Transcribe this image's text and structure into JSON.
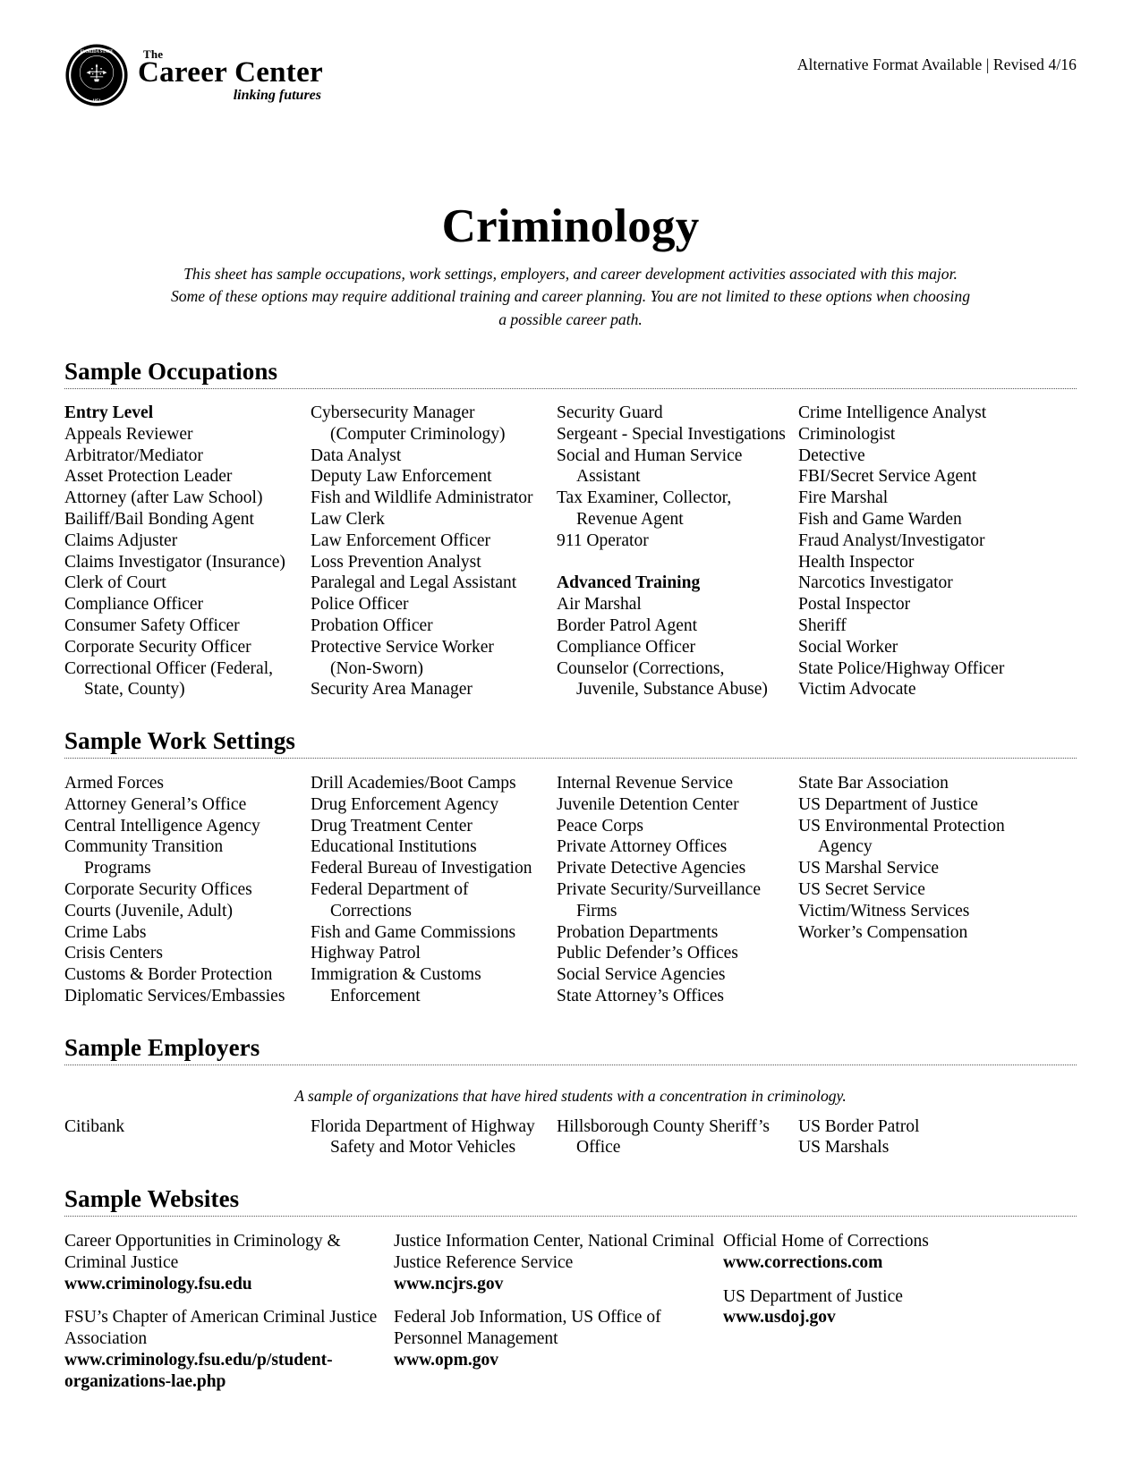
{
  "header": {
    "revised_note": "Alternative Format Available | Revised 4/16",
    "logo": {
      "the": "The",
      "main": "Career Center",
      "tagline": "linking futures",
      "seal_text": "FLORIDA STATE UNIVERSITY 1851"
    }
  },
  "title": "Criminology",
  "subtitle": "This sheet has sample occupations, work settings, employers, and career development activities associated with this major. Some of these options may require additional training and career planning. You are not limited to these options when choosing a possible career path.",
  "sections": {
    "occupations": {
      "heading": "Sample Occupations",
      "columns": [
        {
          "items": [
            {
              "text": "Entry Level",
              "style": "sub-head"
            },
            {
              "text": "Appeals Reviewer",
              "style": "item"
            },
            {
              "text": "Arbitrator/Mediator",
              "style": "item"
            },
            {
              "text": "Asset Protection Leader",
              "style": "item"
            },
            {
              "text": "Attorney (after Law School)",
              "style": "item"
            },
            {
              "text": "Bailiff/Bail Bonding Agent",
              "style": "item"
            },
            {
              "text": "Claims Adjuster",
              "style": "item"
            },
            {
              "text": "Claims Investigator (Insurance)",
              "style": "item"
            },
            {
              "text": "Clerk of Court",
              "style": "item"
            },
            {
              "text": "Compliance Officer",
              "style": "item"
            },
            {
              "text": "Consumer Safety Officer",
              "style": "item"
            },
            {
              "text": "Corporate Security Officer",
              "style": "item"
            },
            {
              "text": "Correctional Officer (Federal,",
              "style": "item"
            },
            {
              "text": "State, County)",
              "style": "cont"
            }
          ]
        },
        {
          "items": [
            {
              "text": "Cybersecurity Manager",
              "style": "item"
            },
            {
              "text": "(Computer Criminology)",
              "style": "cont"
            },
            {
              "text": "Data Analyst",
              "style": "item"
            },
            {
              "text": "Deputy Law Enforcement",
              "style": "item"
            },
            {
              "text": "Fish and Wildlife Administrator",
              "style": "item"
            },
            {
              "text": "Law Clerk",
              "style": "item"
            },
            {
              "text": "Law Enforcement Officer",
              "style": "item"
            },
            {
              "text": "Loss Prevention Analyst",
              "style": "item"
            },
            {
              "text": "Paralegal and Legal Assistant",
              "style": "item"
            },
            {
              "text": "Police Officer",
              "style": "item"
            },
            {
              "text": "Probation Officer",
              "style": "item"
            },
            {
              "text": "Protective Service Worker",
              "style": "item"
            },
            {
              "text": "(Non-Sworn)",
              "style": "cont"
            },
            {
              "text": "Security Area Manager",
              "style": "item"
            }
          ]
        },
        {
          "items": [
            {
              "text": "Security Guard",
              "style": "item"
            },
            {
              "text": "Sergeant - Special Investigations",
              "style": "item"
            },
            {
              "text": "Social and Human Service",
              "style": "item"
            },
            {
              "text": "Assistant",
              "style": "cont"
            },
            {
              "text": "Tax Examiner, Collector,",
              "style": "item"
            },
            {
              "text": "Revenue Agent",
              "style": "cont"
            },
            {
              "text": "911 Operator",
              "style": "item"
            },
            {
              "text": "",
              "style": "spacer"
            },
            {
              "text": "Advanced Training",
              "style": "sub-head"
            },
            {
              "text": "Air Marshal",
              "style": "item"
            },
            {
              "text": "Border Patrol Agent",
              "style": "item"
            },
            {
              "text": "Compliance Officer",
              "style": "item"
            },
            {
              "text": "Counselor (Corrections,",
              "style": "item"
            },
            {
              "text": "Juvenile, Substance Abuse)",
              "style": "cont"
            }
          ]
        },
        {
          "items": [
            {
              "text": "Crime Intelligence Analyst",
              "style": "item"
            },
            {
              "text": "Criminologist",
              "style": "item"
            },
            {
              "text": "Detective",
              "style": "item"
            },
            {
              "text": "FBI/Secret Service Agent",
              "style": "item"
            },
            {
              "text": "Fire Marshal",
              "style": "item"
            },
            {
              "text": "Fish and Game Warden",
              "style": "item"
            },
            {
              "text": "Fraud Analyst/Investigator",
              "style": "item"
            },
            {
              "text": "Health Inspector",
              "style": "item"
            },
            {
              "text": "Narcotics Investigator",
              "style": "item"
            },
            {
              "text": "Postal Inspector",
              "style": "item"
            },
            {
              "text": "Sheriff",
              "style": "item"
            },
            {
              "text": "Social Worker",
              "style": "item"
            },
            {
              "text": "State Police/Highway Officer",
              "style": "item"
            },
            {
              "text": "Victim Advocate",
              "style": "item"
            }
          ]
        }
      ]
    },
    "work_settings": {
      "heading": "Sample Work Settings",
      "columns": [
        {
          "items": [
            {
              "text": "Armed Forces",
              "style": "item"
            },
            {
              "text": "Attorney General’s Office",
              "style": "item"
            },
            {
              "text": "Central Intelligence Agency",
              "style": "item"
            },
            {
              "text": "Community Transition",
              "style": "item"
            },
            {
              "text": "Programs",
              "style": "cont"
            },
            {
              "text": "Corporate Security Offices",
              "style": "item"
            },
            {
              "text": "Courts (Juvenile, Adult)",
              "style": "item"
            },
            {
              "text": "Crime Labs",
              "style": "item"
            },
            {
              "text": "Crisis Centers",
              "style": "item"
            },
            {
              "text": "Customs & Border Protection",
              "style": "item"
            },
            {
              "text": "Diplomatic Services/Embassies",
              "style": "item"
            }
          ]
        },
        {
          "items": [
            {
              "text": "Drill Academies/Boot Camps",
              "style": "item"
            },
            {
              "text": "Drug Enforcement Agency",
              "style": "item"
            },
            {
              "text": "Drug Treatment Center",
              "style": "item"
            },
            {
              "text": "Educational Institutions",
              "style": "item"
            },
            {
              "text": "Federal Bureau of Investigation",
              "style": "item"
            },
            {
              "text": "Federal Department of",
              "style": "item"
            },
            {
              "text": "Corrections",
              "style": "cont"
            },
            {
              "text": "Fish and Game Commissions",
              "style": "item"
            },
            {
              "text": "Highway Patrol",
              "style": "item"
            },
            {
              "text": "Immigration & Customs",
              "style": "item"
            },
            {
              "text": "Enforcement",
              "style": "cont"
            }
          ]
        },
        {
          "items": [
            {
              "text": "Internal Revenue Service",
              "style": "item"
            },
            {
              "text": "Juvenile Detention Center",
              "style": "item"
            },
            {
              "text": "Peace Corps",
              "style": "item"
            },
            {
              "text": "Private Attorney Offices",
              "style": "item"
            },
            {
              "text": "Private Detective Agencies",
              "style": "item"
            },
            {
              "text": "Private Security/Surveillance",
              "style": "item"
            },
            {
              "text": "Firms",
              "style": "cont"
            },
            {
              "text": "Probation Departments",
              "style": "item"
            },
            {
              "text": "Public Defender’s Offices",
              "style": "item"
            },
            {
              "text": "Social Service Agencies",
              "style": "item"
            },
            {
              "text": "State Attorney’s Offices",
              "style": "item"
            }
          ]
        },
        {
          "items": [
            {
              "text": "State Bar Association",
              "style": "item"
            },
            {
              "text": "US Department of Justice",
              "style": "item"
            },
            {
              "text": "US Environmental Protection",
              "style": "item"
            },
            {
              "text": "Agency",
              "style": "cont"
            },
            {
              "text": "US Marshal Service",
              "style": "item"
            },
            {
              "text": "US Secret Service",
              "style": "item"
            },
            {
              "text": "Victim/Witness Services",
              "style": "item"
            },
            {
              "text": "Worker’s Compensation",
              "style": "item"
            }
          ]
        }
      ]
    },
    "employers": {
      "heading": "Sample Employers",
      "note": "A sample of organizations that have hired students with a concentration in criminology.",
      "columns": [
        {
          "items": [
            {
              "text": "Citibank",
              "style": "item"
            }
          ]
        },
        {
          "items": [
            {
              "text": "Florida Department of Highway",
              "style": "item"
            },
            {
              "text": "Safety and Motor Vehicles",
              "style": "cont"
            }
          ]
        },
        {
          "items": [
            {
              "text": "Hillsborough County Sheriff’s",
              "style": "item"
            },
            {
              "text": "Office",
              "style": "cont"
            }
          ]
        },
        {
          "items": [
            {
              "text": "US Border Patrol",
              "style": "item"
            },
            {
              "text": "US Marshals",
              "style": "item"
            }
          ]
        }
      ]
    },
    "websites": {
      "heading": "Sample Websites",
      "columns": [
        {
          "entries": [
            {
              "name": "Career Opportunities in Criminology & Criminal Justice",
              "url": "www.criminology.fsu.edu"
            },
            {
              "name": "FSU’s Chapter of American Criminal Justice Association",
              "url": "www.criminology.fsu.edu/p/student-organizations-lae.php"
            }
          ]
        },
        {
          "entries": [
            {
              "name": "Justice Information Center, National Criminal Justice Reference Service",
              "url": "www.ncjrs.gov"
            },
            {
              "name": "Federal Job Information, US Office of Personnel Management",
              "url": "www.opm.gov"
            }
          ]
        },
        {
          "entries": [
            {
              "name": "Official Home of Corrections",
              "url": "www.corrections.com"
            },
            {
              "name": "US Department of Justice",
              "url": "www.usdoj.gov"
            }
          ]
        }
      ]
    }
  }
}
